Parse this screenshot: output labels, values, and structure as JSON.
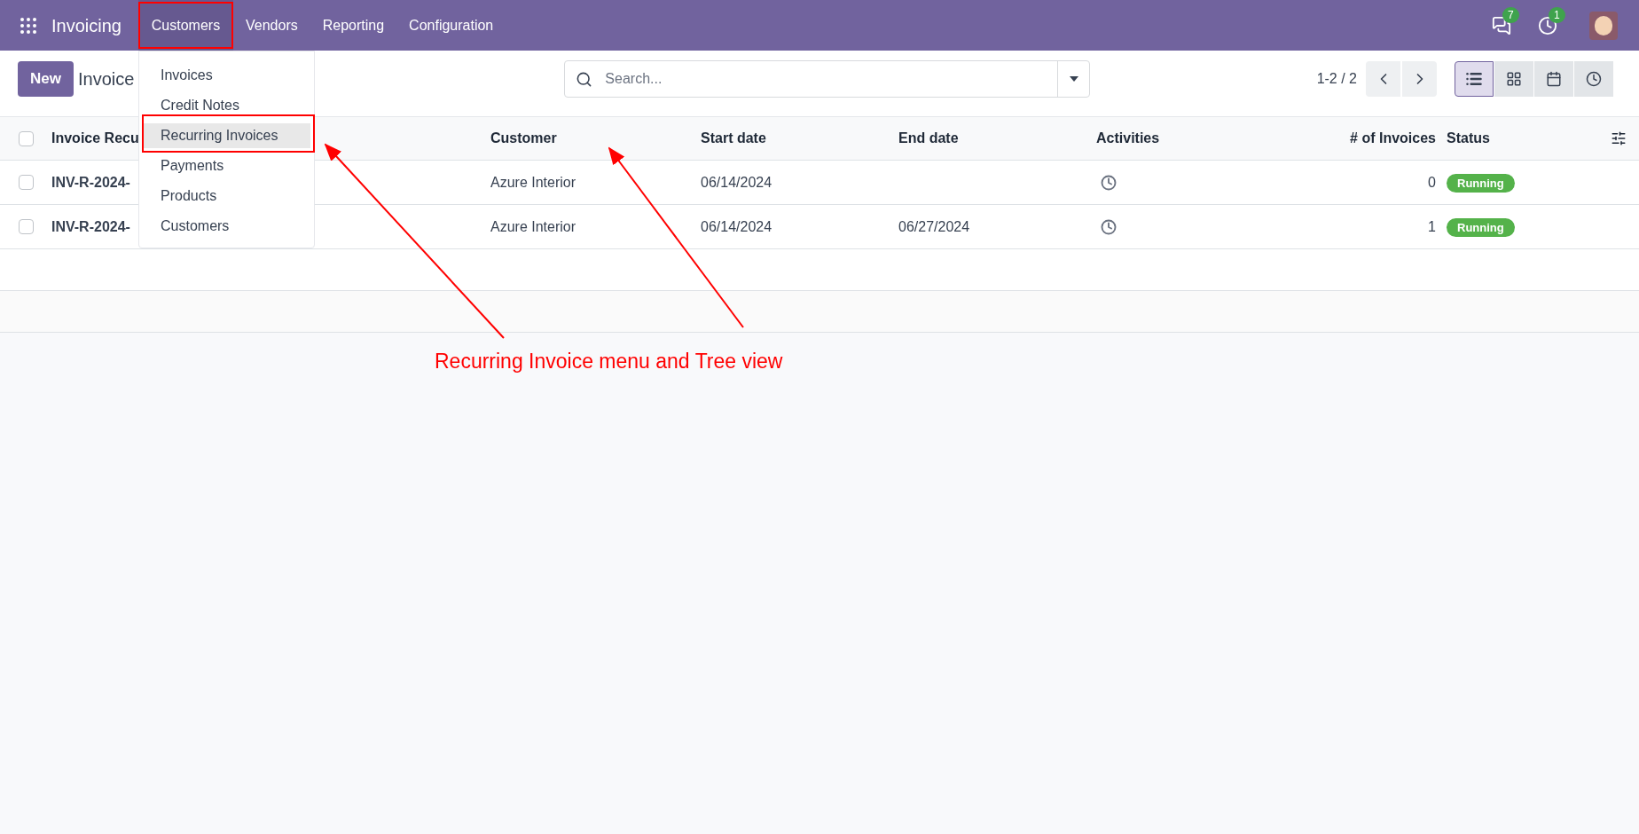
{
  "navbar": {
    "app_name": "Invoicing",
    "menus": [
      {
        "label": "Customers",
        "selected": true
      },
      {
        "label": "Vendors",
        "selected": false
      },
      {
        "label": "Reporting",
        "selected": false
      },
      {
        "label": "Configuration",
        "selected": false
      }
    ],
    "messages_badge": "7",
    "activities_badge": "1"
  },
  "dropdown": {
    "items": [
      {
        "label": "Invoices",
        "selected": false
      },
      {
        "label": "Credit Notes",
        "selected": false
      },
      {
        "label": "Recurring Invoices",
        "selected": true
      },
      {
        "label": "Payments",
        "selected": false
      },
      {
        "label": "Products",
        "selected": false
      },
      {
        "label": "Customers",
        "selected": false
      }
    ]
  },
  "control_panel": {
    "new_button": "New",
    "breadcrumb": "Invoice",
    "search": {
      "placeholder": "Search..."
    },
    "pager": "1-2 / 2",
    "views": [
      {
        "kind": "list",
        "selected": true
      },
      {
        "kind": "kanban",
        "selected": false
      },
      {
        "kind": "calendar",
        "selected": false
      },
      {
        "kind": "activity",
        "selected": false
      }
    ]
  },
  "table": {
    "select_all_checked": false,
    "columns": [
      "Invoice Recu",
      "Customer",
      "Start date",
      "End date",
      "Activities",
      "# of Invoices",
      "Status"
    ],
    "rows": [
      {
        "checked": false,
        "name": "INV-R-2024-",
        "customer": "Azure Interior",
        "start_date": "06/14/2024",
        "end_date": "",
        "invoices": "0",
        "status": "Running"
      },
      {
        "checked": false,
        "name": "INV-R-2024-",
        "customer": "Azure Interior",
        "start_date": "06/14/2024",
        "end_date": "06/27/2024",
        "invoices": "1",
        "status": "Running"
      }
    ]
  },
  "annotation": {
    "text": "Recurring Invoice menu and Tree view"
  }
}
